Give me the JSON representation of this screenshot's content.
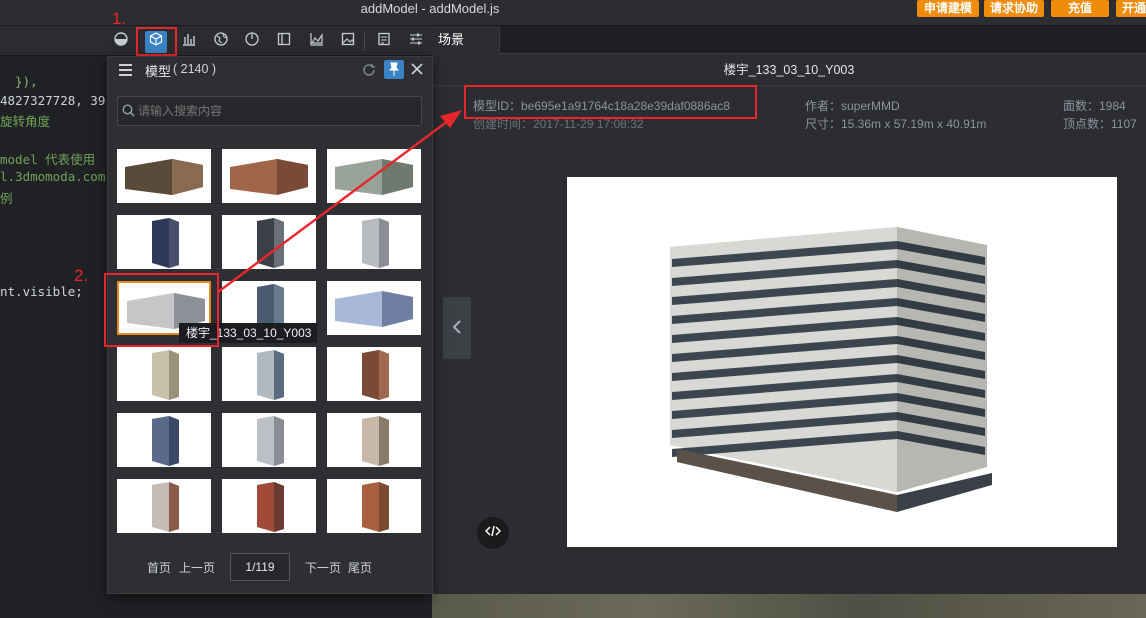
{
  "window": {
    "title": "addModel - addModel.js"
  },
  "top_buttons": [
    "申请建模",
    "请求协助",
    "充值",
    "开通"
  ],
  "editor": {
    "lines": [
      "  }),",
      "4827327728, 39",
      "旋转角度",
      "model 代表使用",
      "l.3dmomoda.com",
      "例",
      "nt.visible;"
    ]
  },
  "toolbar": {
    "icons": [
      "half-circle-icon",
      "cube-icon",
      "chart-icon",
      "globe-icon",
      "clock-icon",
      "panel-icon",
      "area-chart-icon",
      "image-icon",
      "document-icon",
      "sliders-icon"
    ]
  },
  "annotations": {
    "step1": "1.",
    "step2": "2."
  },
  "model_panel": {
    "title": "模型",
    "count": "( 2140 )",
    "search_placeholder": "请输入搜索内容",
    "tooltip": "楼宇_133_03_10_Y003",
    "pagination": {
      "first": "首页",
      "prev": "上一页",
      "page": "1/119",
      "next": "下一页",
      "last": "尾页"
    }
  },
  "right": {
    "tab": "场景",
    "model_name": "楼宇_133_03_10_Y003",
    "model_id": "模型ID：be695e1a91764c18a28e39daf0886ac8",
    "created": "创建时间：2017-11-29 17:08:32",
    "author": "作者：superMMD",
    "size": "尺寸：15.36m x 57.19m x 40.91m",
    "faces": "面数：1984",
    "vertices": "顶点数：1107"
  },
  "colors": {
    "accent_orange": "#f08c0a",
    "annotation_red": "#e8262b",
    "selected_border": "#e38b1d"
  }
}
